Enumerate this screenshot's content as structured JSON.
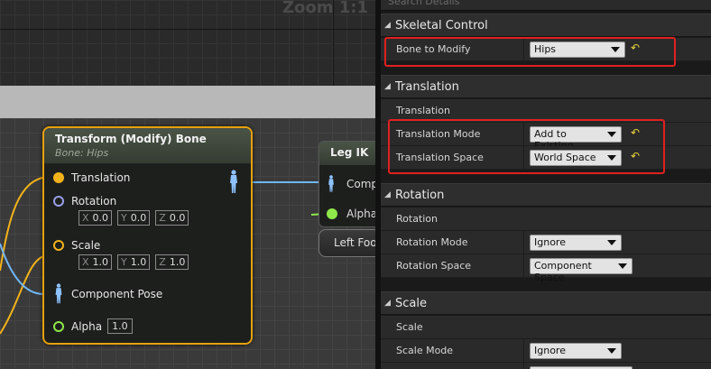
{
  "graph": {
    "zoom_label": "Zoom 1:1",
    "transform_node": {
      "title": "Transform (Modify) Bone",
      "subtitle": "Bone: Hips",
      "pins": {
        "translation": "Translation",
        "rotation": "Rotation",
        "scale": "Scale",
        "component_pose": "Component Pose",
        "alpha": "Alpha"
      },
      "axis_labels": {
        "x": "X",
        "y": "Y",
        "z": "Z"
      },
      "rotation": {
        "x": "0.0",
        "y": "0.0",
        "z": "0.0"
      },
      "scale": {
        "x": "1.0",
        "y": "1.0",
        "z": "1.0"
      },
      "alpha_value": "1.0"
    },
    "leg_ik_node": {
      "title": "Leg IK",
      "pin_comp": "Comp",
      "pin_alpha": "Alpha"
    },
    "left_foot_node": {
      "label": "Left Foo"
    }
  },
  "details": {
    "search_placeholder": "Search Details",
    "sections": {
      "skeletal_control": "Skeletal Control",
      "translation": "Translation",
      "rotation": "Rotation",
      "scale": "Scale"
    },
    "props": {
      "bone_to_modify": {
        "label": "Bone to Modify",
        "value": "Hips"
      },
      "translation_heading": "Translation",
      "translation_mode": {
        "label": "Translation Mode",
        "value": "Add to Existing"
      },
      "translation_space": {
        "label": "Translation Space",
        "value": "World Space"
      },
      "rotation_heading": "Rotation",
      "rotation_mode": {
        "label": "Rotation Mode",
        "value": "Ignore"
      },
      "rotation_space": {
        "label": "Rotation Space",
        "value": "Component Space"
      },
      "scale_heading": "Scale",
      "scale_mode": {
        "label": "Scale Mode",
        "value": "Ignore"
      }
    },
    "reset_glyph": "↶"
  },
  "colors": {
    "node_border": "#e6a10c",
    "pin_yellow": "#f2b21a",
    "pin_blue": "#9a9fe8",
    "pin_green": "#8fe84a",
    "wire_blue": "#6fb6f5",
    "highlight_red": "#e02020"
  }
}
